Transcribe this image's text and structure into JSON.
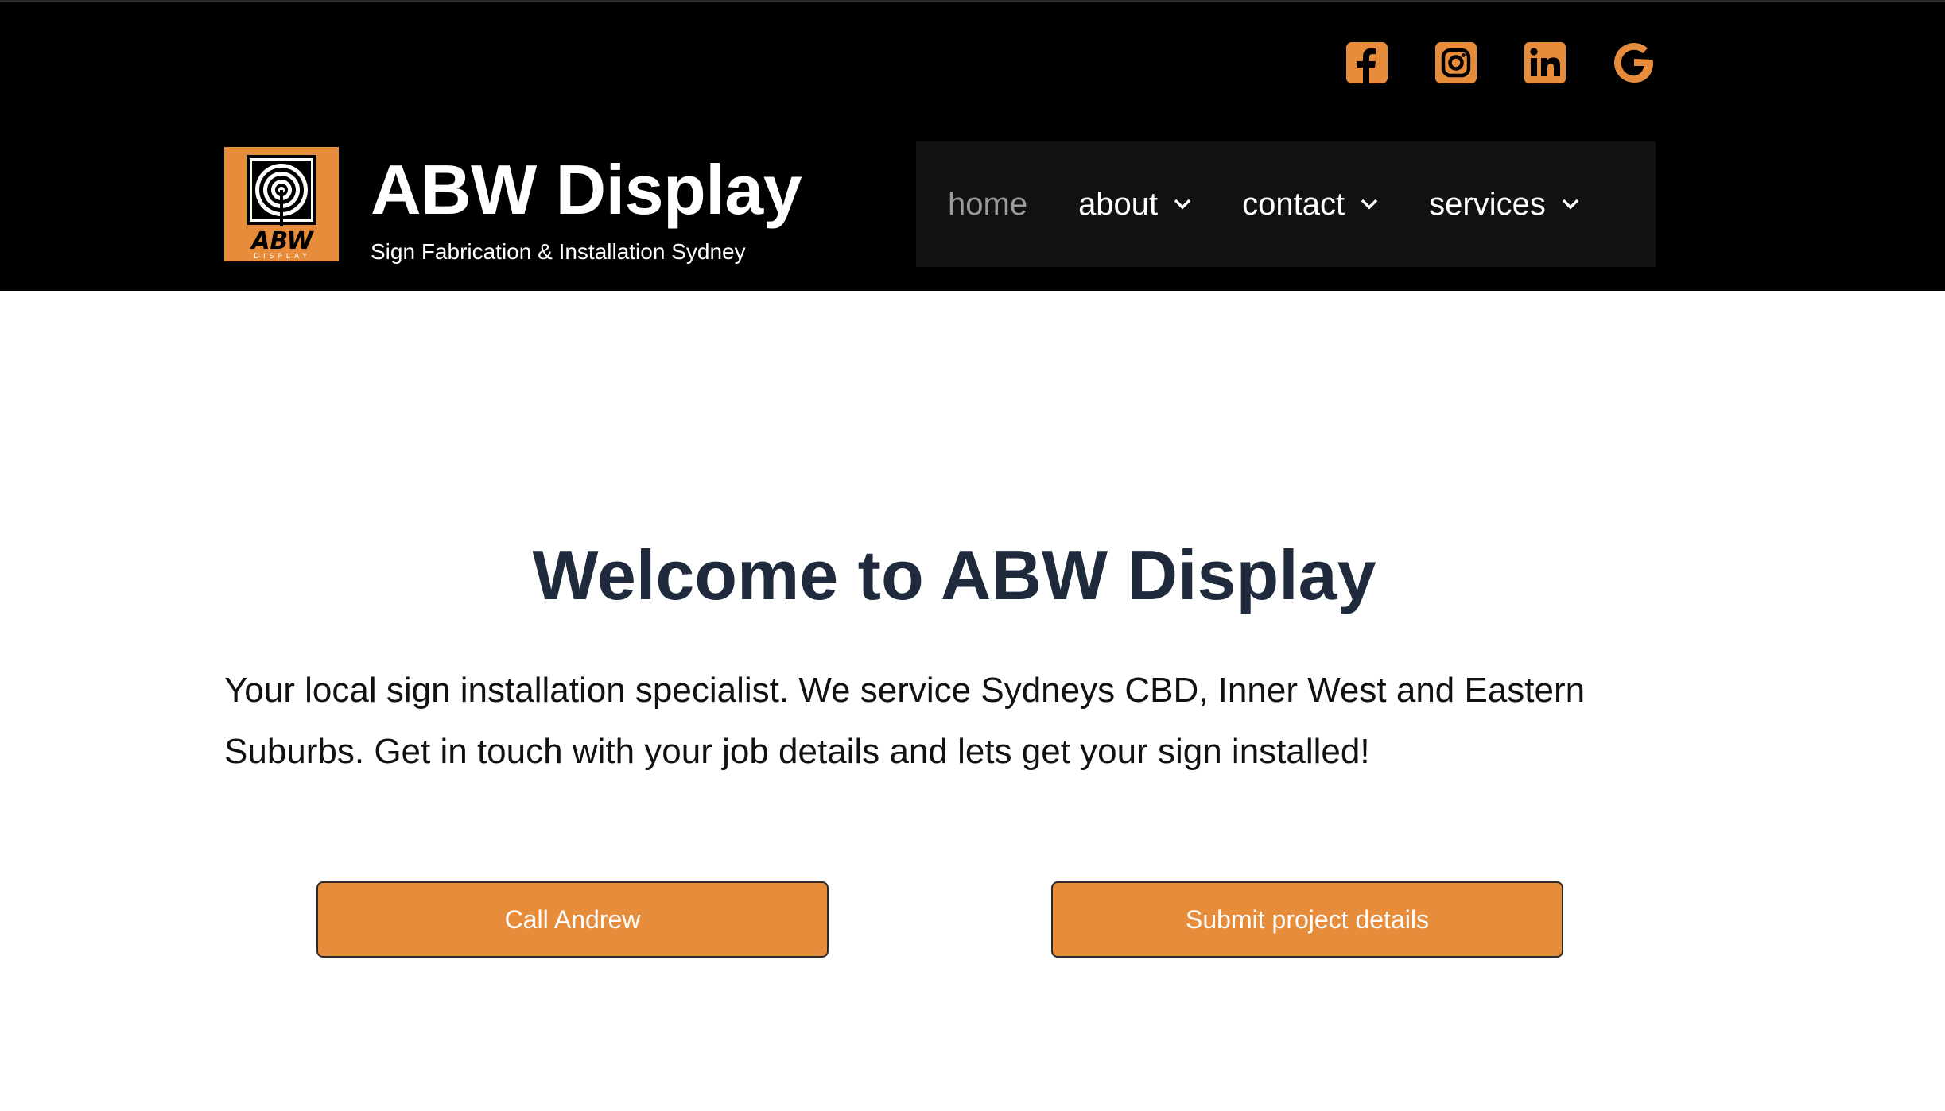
{
  "colors": {
    "accent": "#e78c3a",
    "header_bg": "#000000",
    "nav_bg": "#111111",
    "heading": "#1f2a3c"
  },
  "socials": [
    {
      "icon": "facebook-icon"
    },
    {
      "icon": "instagram-icon"
    },
    {
      "icon": "linkedin-icon"
    },
    {
      "icon": "google-icon"
    }
  ],
  "brand": {
    "title": "ABW Display",
    "tagline": "Sign Fabrication & Installation Sydney",
    "logo_text": "ABW",
    "logo_subtext": "DISPLAY"
  },
  "nav": {
    "items": [
      {
        "label": "home",
        "active": true
      },
      {
        "label": "about",
        "dropdown": true
      },
      {
        "label": "contact",
        "dropdown": true
      },
      {
        "label": "services",
        "dropdown": true
      }
    ]
  },
  "hero": {
    "title": "Welcome to ABW Display",
    "text": "Your local sign installation specialist. We service Sydneys CBD, Inner West and Eastern Suburbs. Get in touch with your job details and lets get your sign installed!",
    "buttons": {
      "call": "Call Andrew",
      "submit": "Submit project details"
    }
  }
}
